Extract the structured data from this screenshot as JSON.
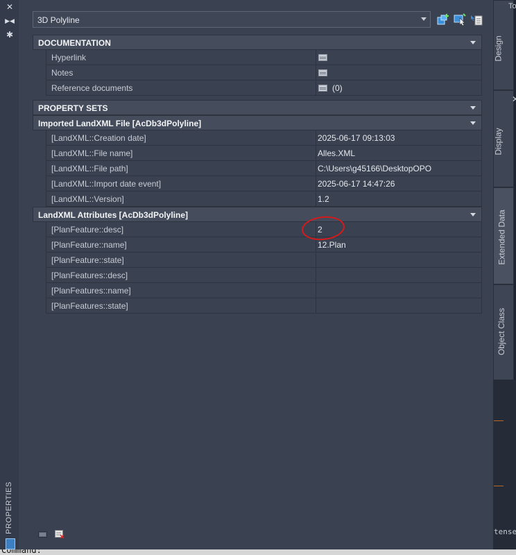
{
  "selector": {
    "value": "3D Polyline"
  },
  "toolbar": {
    "icons": [
      "add-to-selection-icon",
      "quick-select-icon",
      "pickadd-toggle-icon"
    ]
  },
  "categories": [
    {
      "title": "DOCUMENTATION",
      "rows": [
        {
          "key": "Hyperlink",
          "value": ""
        },
        {
          "key": "Notes",
          "value": ""
        },
        {
          "key": "Reference documents",
          "value": "(0)"
        }
      ]
    },
    {
      "title": "PROPERTY SETS"
    },
    {
      "title": "Imported LandXML File [AcDb3dPolyline]",
      "rows": [
        {
          "key": "[LandXML::Creation date]",
          "value": "2025-06-17 09:13:03"
        },
        {
          "key": "[LandXML::File name]",
          "value": "Alles.XML"
        },
        {
          "key": "[LandXML::File path]",
          "value": "C:\\Users\\g45166\\DesktopOPO"
        },
        {
          "key": "[LandXML::Import date event]",
          "value": "2025-06-17 14:47:26"
        },
        {
          "key": "[LandXML::Version]",
          "value": "1.2"
        }
      ]
    },
    {
      "title": "LandXML Attributes [AcDb3dPolyline]",
      "rows": [
        {
          "key": "[PlanFeature::desc]",
          "value": "2"
        },
        {
          "key": "[PlanFeature::name]",
          "value": "12.Plan"
        },
        {
          "key": "[PlanFeature::state]",
          "value": ""
        },
        {
          "key": "[PlanFeatures::desc]",
          "value": ""
        },
        {
          "key": "[PlanFeatures::name]",
          "value": ""
        },
        {
          "key": "[PlanFeatures::state]",
          "value": ""
        }
      ]
    }
  ],
  "tabs": {
    "design": "Design",
    "display": "Display",
    "extended": "Extended Data",
    "object_class": "Object Class"
  },
  "side": {
    "palette_title": "PROPERTIES",
    "top_right_fragment": "To",
    "tense_fragment": "tense",
    "command": "Command:"
  },
  "colors": {
    "palette_bg": "#3a4252",
    "highlight_circle": "#d61a1a",
    "active_tab": "#4a5262"
  }
}
